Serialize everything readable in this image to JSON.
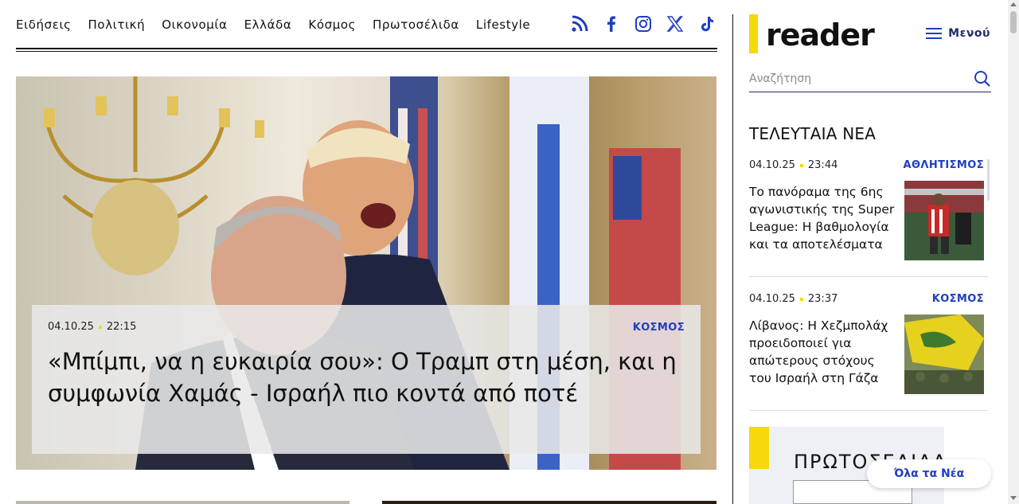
{
  "nav": {
    "items": [
      "Ειδήσεις",
      "Πολιτική",
      "Οικονομία",
      "Ελλάδα",
      "Κόσμος",
      "Πρωτοσέλιδα",
      "Lifestyle"
    ]
  },
  "social": {
    "icons": [
      "rss-icon",
      "facebook-icon",
      "instagram-icon",
      "x-icon",
      "tiktok-icon"
    ],
    "color": "#1f3ebf"
  },
  "hero": {
    "date": "04.10.25",
    "time": "22:15",
    "category": "ΚΟΣΜΟΣ",
    "title": "«Μπίμπι, να η ευκαιρία σου»: Ο Τραμπ στη μέση, και η συμφωνία Χαμάς - Ισραήλ πιο κοντά από ποτέ"
  },
  "sidebar": {
    "logo": "reader",
    "menu_label": "Μενού",
    "search_placeholder": "Αναζήτηση",
    "latest_heading": "ΤΕΛΕΥΤΑΙΑ ΝΕΑ",
    "news": [
      {
        "date": "04.10.25",
        "time": "23:44",
        "category": "ΑΘΛΗΤΙΣΜΟΣ",
        "title": "Το πανόραμα της 6ης αγωνιστικής της Super League: Η βαθμολογία και τα αποτελέσματα"
      },
      {
        "date": "04.10.25",
        "time": "23:37",
        "category": "ΚΟΣΜΟΣ",
        "title": "Λίβανος: Η Χεζμπολάχ προειδοποιεί για απώτερους στόχους του Ισραήλ στη Γάζα"
      }
    ],
    "frontpages_label": "ΠΡΩΤΟΣΕΛΙΔΑ",
    "all_news_label": "Όλα τα Νέα"
  },
  "colors": {
    "accent": "#f5d90a",
    "link": "#1f3ebf",
    "dark_blue": "#1f2a6a"
  }
}
